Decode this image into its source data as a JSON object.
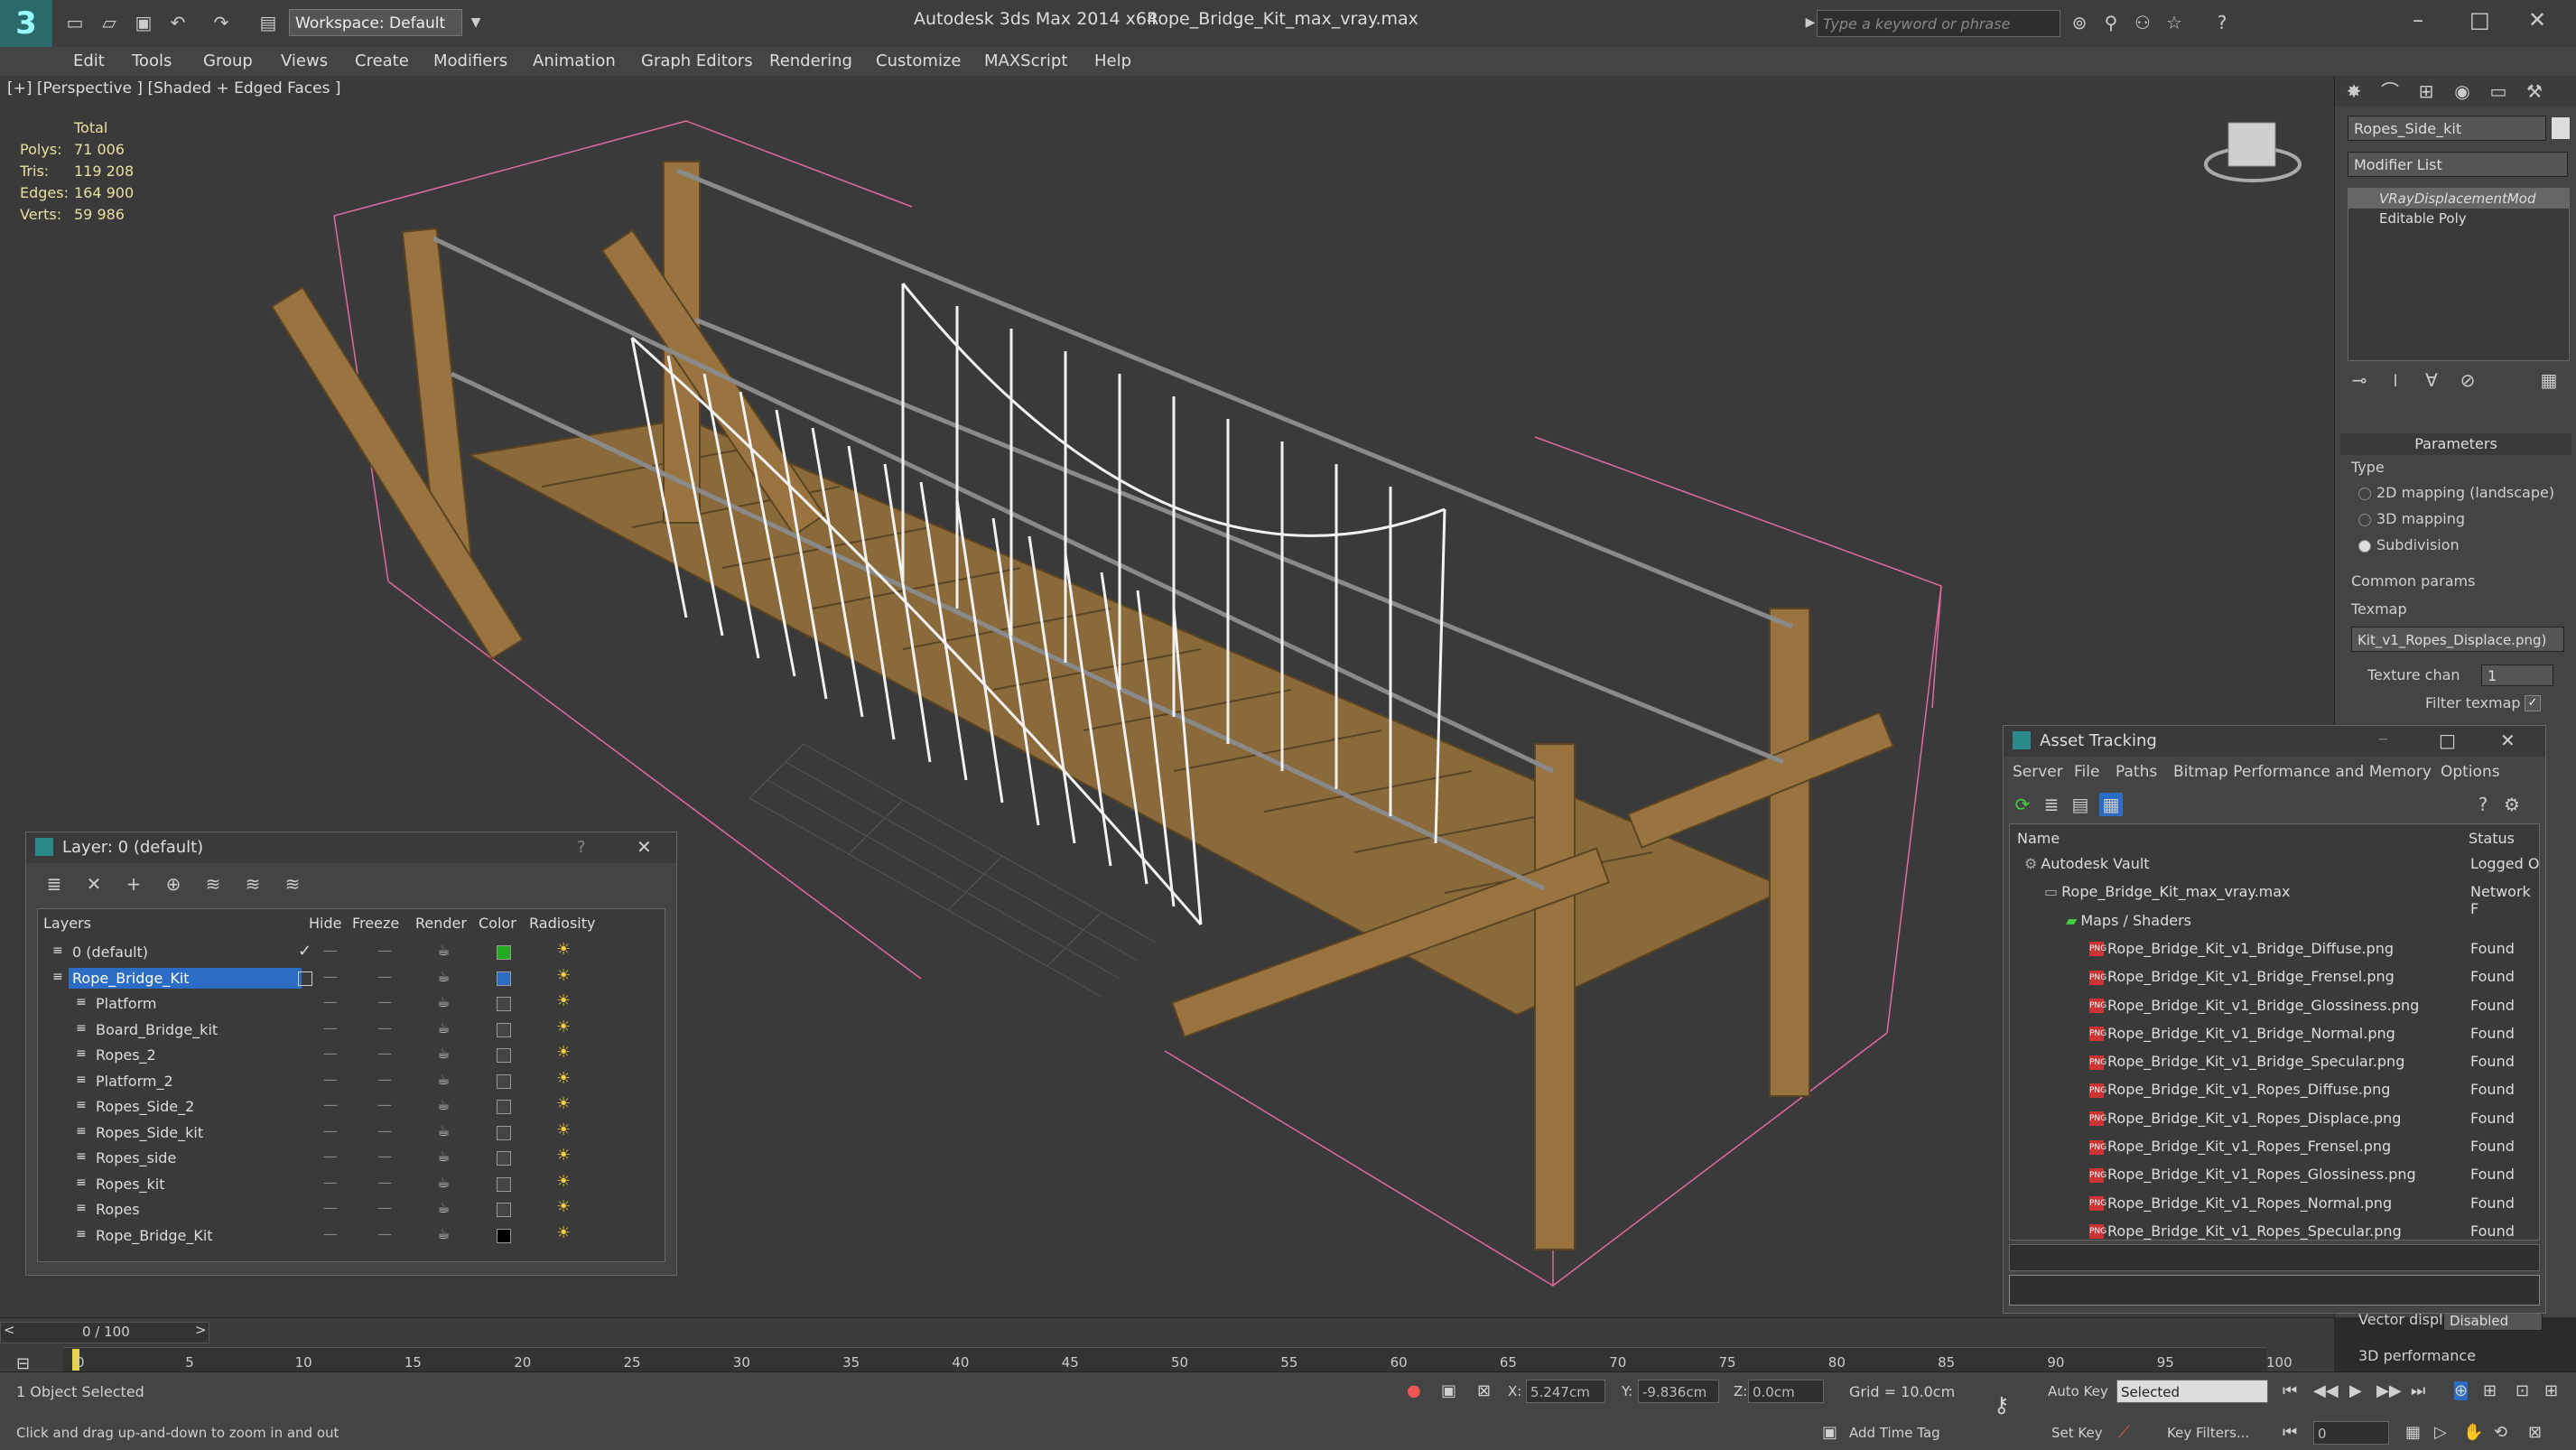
{
  "app": {
    "title": "Autodesk 3ds Max  2014 x64",
    "file": "Rope_Bridge_Kit_max_vray.max",
    "workspace": "Workspace: Default",
    "search_placeholder": "Type a keyword or phrase"
  },
  "menu": [
    "Edit",
    "Tools",
    "Group",
    "Views",
    "Create",
    "Modifiers",
    "Animation",
    "Graph Editors",
    "Rendering",
    "Customize",
    "MAXScript",
    "Help"
  ],
  "viewport": {
    "label": "[+] [Perspective ] [Shaded + Edged Faces ]",
    "stats": {
      "header": "Total",
      "rows": [
        {
          "label": "Polys:",
          "value": "71 006"
        },
        {
          "label": "Tris:",
          "value": "119 208"
        },
        {
          "label": "Edges:",
          "value": "164 900"
        },
        {
          "label": "Verts:",
          "value": "59 986"
        }
      ]
    }
  },
  "command_panel": {
    "object_name": "Ropes_Side_kit",
    "modifier_list": "Modifier List",
    "stack": [
      "VRayDisplacementMod",
      "Editable Poly"
    ],
    "parameters_title": "Parameters",
    "type_label": "Type",
    "types": [
      "2D mapping (landscape)",
      "3D mapping",
      "Subdivision"
    ],
    "selected_type": 2,
    "common_params": "Common params",
    "texmap_label": "Texmap",
    "texmap_value": "Kit_v1_Ropes_Displace.png)",
    "texture_chan_label": "Texture chan",
    "texture_chan_value": "1",
    "filter_texmap": "Filter texmap",
    "vector_disp_label": "Vector displ",
    "vector_disp_value": "Disabled",
    "perf_label": "3D performance"
  },
  "layer_window": {
    "title": "Layer: 0 (default)",
    "columns": [
      "Layers",
      "Hide",
      "Freeze",
      "Render",
      "Color",
      "Radiosity"
    ],
    "rows": [
      {
        "name": "0 (default)",
        "color": "#22aa22",
        "level": 0,
        "current": true,
        "selected": false
      },
      {
        "name": "Rope_Bridge_Kit",
        "color": "#2b6cc4",
        "level": 0,
        "current": false,
        "selected": true
      },
      {
        "name": "Platform",
        "color": "#444444",
        "level": 1,
        "current": false,
        "selected": false
      },
      {
        "name": "Board_Bridge_kit",
        "color": "#444444",
        "level": 1,
        "current": false,
        "selected": false
      },
      {
        "name": "Ropes_2",
        "color": "#444444",
        "level": 1,
        "current": false,
        "selected": false
      },
      {
        "name": "Platform_2",
        "color": "#444444",
        "level": 1,
        "current": false,
        "selected": false
      },
      {
        "name": "Ropes_Side_2",
        "color": "#444444",
        "level": 1,
        "current": false,
        "selected": false
      },
      {
        "name": "Ropes_Side_kit",
        "color": "#444444",
        "level": 1,
        "current": false,
        "selected": false
      },
      {
        "name": "Ropes_side",
        "color": "#444444",
        "level": 1,
        "current": false,
        "selected": false
      },
      {
        "name": "Ropes_kit",
        "color": "#444444",
        "level": 1,
        "current": false,
        "selected": false
      },
      {
        "name": "Ropes",
        "color": "#444444",
        "level": 1,
        "current": false,
        "selected": false
      },
      {
        "name": "Rope_Bridge_Kit",
        "color": "#000000",
        "level": 1,
        "current": false,
        "selected": false
      }
    ]
  },
  "asset_window": {
    "title": "Asset Tracking",
    "menu": [
      "Server",
      "File",
      "Paths",
      "Bitmap Performance and Memory",
      "Options"
    ],
    "columns": [
      "Name",
      "Status"
    ],
    "rows": [
      {
        "name": "Autodesk Vault",
        "status": "Logged O",
        "level": 0,
        "kind": "vault"
      },
      {
        "name": "Rope_Bridge_Kit_max_vray.max",
        "status": "Network F",
        "level": 1,
        "kind": "max"
      },
      {
        "name": "Maps / Shaders",
        "status": "",
        "level": 2,
        "kind": "folder"
      },
      {
        "name": "Rope_Bridge_Kit_v1_Bridge_Diffuse.png",
        "status": "Found",
        "level": 3,
        "kind": "png"
      },
      {
        "name": "Rope_Bridge_Kit_v1_Bridge_Frensel.png",
        "status": "Found",
        "level": 3,
        "kind": "png"
      },
      {
        "name": "Rope_Bridge_Kit_v1_Bridge_Glossiness.png",
        "status": "Found",
        "level": 3,
        "kind": "png"
      },
      {
        "name": "Rope_Bridge_Kit_v1_Bridge_Normal.png",
        "status": "Found",
        "level": 3,
        "kind": "png"
      },
      {
        "name": "Rope_Bridge_Kit_v1_Bridge_Specular.png",
        "status": "Found",
        "level": 3,
        "kind": "png"
      },
      {
        "name": "Rope_Bridge_Kit_v1_Ropes_Diffuse.png",
        "status": "Found",
        "level": 3,
        "kind": "png"
      },
      {
        "name": "Rope_Bridge_Kit_v1_Ropes_Displace.png",
        "status": "Found",
        "level": 3,
        "kind": "png"
      },
      {
        "name": "Rope_Bridge_Kit_v1_Ropes_Frensel.png",
        "status": "Found",
        "level": 3,
        "kind": "png"
      },
      {
        "name": "Rope_Bridge_Kit_v1_Ropes_Glossiness.png",
        "status": "Found",
        "level": 3,
        "kind": "png"
      },
      {
        "name": "Rope_Bridge_Kit_v1_Ropes_Normal.png",
        "status": "Found",
        "level": 3,
        "kind": "png"
      },
      {
        "name": "Rope_Bridge_Kit_v1_Ropes_Specular.png",
        "status": "Found",
        "level": 3,
        "kind": "png"
      }
    ]
  },
  "timeline": {
    "frame": "0 / 100",
    "ticks": [
      "0",
      "5",
      "10",
      "15",
      "20",
      "25",
      "30",
      "35",
      "40",
      "45",
      "50",
      "55",
      "60",
      "65",
      "70",
      "75",
      "80",
      "85",
      "90",
      "95",
      "100"
    ]
  },
  "status": {
    "selection": "1 Object Selected",
    "prompt": "Click and drag up-and-down to zoom in and out",
    "x": "5.247cm",
    "y": "-9.836cm",
    "z": "0.0cm",
    "grid": "Grid = 10.0cm",
    "auto_key": "Auto Key",
    "set_key": "Set Key",
    "key_mode": "Selected",
    "key_filters": "Key Filters...",
    "add_time_tag": "Add Time Tag",
    "frame_field": "0"
  },
  "colors": {
    "selection_blue": "#2b6cc4",
    "bbox_pink": "#e06aa0",
    "wood": "#8a6a3a",
    "rope": "#f2f2f2"
  }
}
